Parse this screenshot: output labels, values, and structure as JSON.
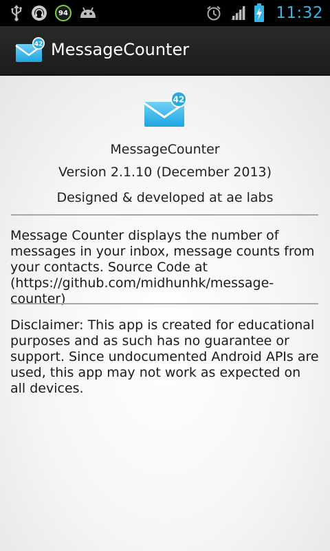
{
  "status_bar": {
    "battery_label": "94",
    "clock": "11:32",
    "accent_color": "#33b5e5",
    "icons": [
      "usb-icon",
      "headphones-icon",
      "battery-monitor-icon",
      "android-icon",
      "alarm-icon",
      "signal-icon",
      "battery-charging-icon"
    ]
  },
  "action_bar": {
    "title": "MessageCounter",
    "icon_badge": "42"
  },
  "about": {
    "icon_badge": "42",
    "app_name": "MessageCounter",
    "version": "Version 2.1.10 (December 2013)",
    "credit": "Designed & developed at ae labs",
    "description": "Message Counter displays the number of messages in your inbox, message counts from your contacts. Source Code at (https://github.com/midhunhk/message-counter)",
    "disclaimer": "Disclaimer: This app is created for educational purposes and as such has no guarantee or support. Since undocumented Android APIs are used, this app may not work as expected on all devices."
  }
}
